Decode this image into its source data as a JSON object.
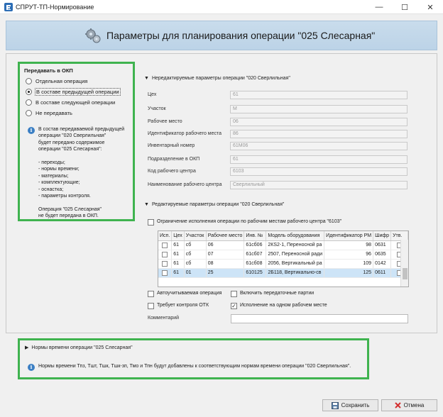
{
  "window": {
    "title": "СПРУТ-ТП-Нормирование",
    "minimize": "—",
    "maximize": "☐",
    "close": "✕"
  },
  "header": {
    "title": "Параметры для планирования операции \"025 Слесарная\""
  },
  "transfer": {
    "title": "Передавать в ОКП",
    "options": [
      {
        "label": "Отдельная операция",
        "checked": false
      },
      {
        "label": "В составе предыдущей операции",
        "checked": true
      },
      {
        "label": "В составе следующей операции",
        "checked": false
      },
      {
        "label": "Не передавать",
        "checked": false
      }
    ],
    "info_lines": [
      "В состав передаваемой предыдущей",
      "операции \"020 Сверлильная\"",
      "будет передано содержимое",
      "операции \"025 Слесарная\":",
      "",
      "- переходы;",
      "- нормы времени;",
      "- материалы;",
      "- комплектующие;",
      "- оснастка;",
      "- параметры контроля.",
      "",
      "Операция \"025 Слесарная\"",
      "не будет передана в ОКП."
    ]
  },
  "readonly_section": {
    "title": "Нередактируемые параметры операции \"020 Сверлильная\"",
    "fields": [
      {
        "label": "Цех",
        "value": "61"
      },
      {
        "label": "Участок",
        "value": "М"
      },
      {
        "label": "Рабочее место",
        "value": "06"
      },
      {
        "label": "Идентификатор рабочего места",
        "value": "86"
      },
      {
        "label": "Инвентарный номер",
        "value": "61М06"
      },
      {
        "label": "Подразделение в ОКП",
        "value": "61"
      },
      {
        "label": "Код рабочего центра",
        "value": "6103"
      },
      {
        "label": "Наименование рабочего центра",
        "value": "Сверлильный"
      }
    ]
  },
  "editable_section": {
    "title": "Редактируемые параметры операции \"020 Сверлильная\"",
    "restrict_label": "Ограничение исполнения операции по рабочим местам рабочего центра \"6103\"",
    "restrict_checked": false,
    "table": {
      "columns": [
        "Исп.",
        "Цех",
        "Участок",
        "Рабочее место",
        "Инв. №",
        "Модель оборудования",
        "Идентификатор РМ",
        "Шифр",
        "Утв."
      ],
      "rows": [
        [
          "",
          "61",
          "сб",
          "06",
          "61сб06",
          "2КS2-1, Переносной ра",
          "98",
          "0631",
          ""
        ],
        [
          "",
          "61",
          "сб",
          "07",
          "61сб07",
          "2507, Переносной ради",
          "96",
          "0635",
          ""
        ],
        [
          "",
          "61",
          "сб",
          "08",
          "61сб08",
          "2056, Вертикальный ра",
          "109",
          "0142",
          ""
        ],
        [
          "",
          "61",
          "01",
          "25",
          "610125",
          "2Б118, Вертикально-св",
          "125",
          "0611",
          ""
        ]
      ]
    },
    "checkboxes": [
      {
        "label": "Автоучитываемая операция",
        "checked": false
      },
      {
        "label": "Включить передаточные партии",
        "checked": false
      },
      {
        "label": "Требует контроля ОТК",
        "checked": false
      },
      {
        "label": "Исполнение на одном рабочем месте",
        "checked": true
      }
    ],
    "comment_label": "Комментарий",
    "comment_value": ""
  },
  "norms": {
    "title": "Нормы времени операции \"025 Слесарная\"",
    "info": "Нормы времени Тпз, Тшт, Тшк, Тшк-зп, Тмо и Тпн будут добавлены к соответствующим нормам времени операции \"020 Сверлильная\"."
  },
  "footer": {
    "save_label": "Сохранить",
    "cancel_label": "Отмена"
  },
  "colors": {
    "highlight_border": "#3fb34f",
    "banner": "#c9dcec",
    "info_icon": "#3b7fc4",
    "selected_row": "#cde4f7"
  }
}
